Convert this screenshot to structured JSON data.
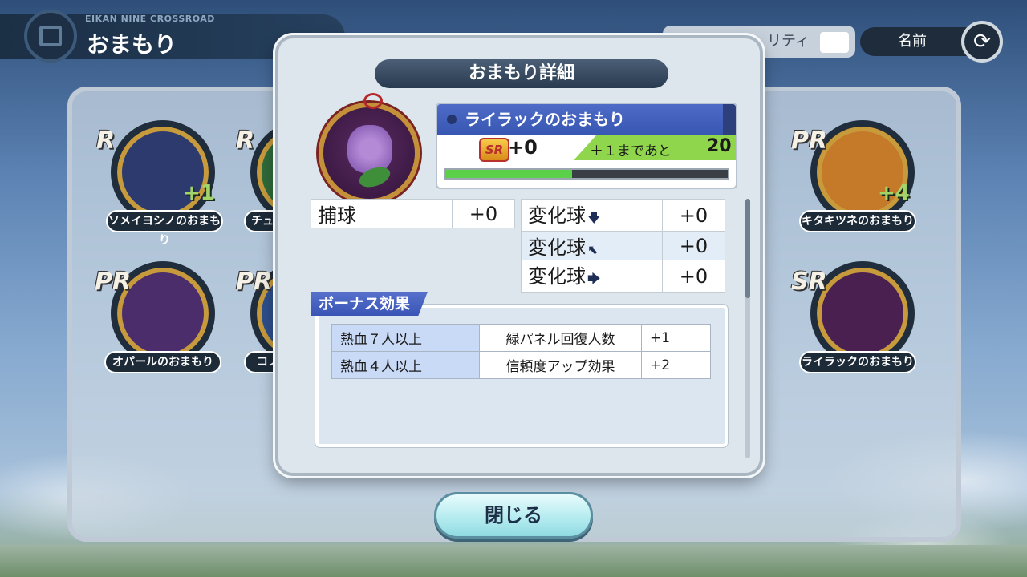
{
  "header": {
    "subtitle": "EIKAN NINE CROSSROAD",
    "title": "おまもり",
    "sort_label": "リティ",
    "name_sort": "名前"
  },
  "background_charms": [
    {
      "rank": "R",
      "label": "ソメイヨシノのおまもり",
      "plus": "+1",
      "color": "#2d3a6e"
    },
    {
      "rank": "R",
      "label": "チュー",
      "plus": "",
      "color": "#2f6a3a"
    },
    {
      "rank": "PR",
      "label": "キタキツネのおまもり",
      "plus": "+4",
      "color": "#c47a28"
    },
    {
      "rank": "PR",
      "label": "オパールのおまもり",
      "plus": "",
      "color": "#4a2d6a"
    },
    {
      "rank": "PR",
      "label": "コノ",
      "plus": "",
      "color": "#2d4f8a"
    },
    {
      "rank": "SR",
      "label": "ライラックのおまもり",
      "plus": "",
      "color": "#4a2050"
    }
  ],
  "modal": {
    "title": "おまもり詳細",
    "charm_name": "ライラックのおまもり",
    "rank": "SR",
    "level": "+0",
    "next_label": "＋１まであと",
    "next_value": "20",
    "progress": 0.45,
    "stats_left": [
      {
        "name": "捕球",
        "value": "+0"
      }
    ],
    "stats_right": [
      {
        "name": "変化球",
        "dir": "down-arrow-icon",
        "glyph": "🡇",
        "value": "+0"
      },
      {
        "name": "変化球",
        "dir": "down-left-arrow-icon",
        "glyph": "⬉",
        "value": "+0"
      },
      {
        "name": "変化球",
        "dir": "right-arrow-icon",
        "glyph": "🡆",
        "value": "+0"
      }
    ],
    "bonus_title": "ボーナス効果",
    "bonuses": [
      {
        "condition": "熱血７人以上",
        "effect": "緑パネル回復人数",
        "value": "+1"
      },
      {
        "condition": "熱血４人以上",
        "effect": "信頼度アップ効果",
        "value": "+2"
      }
    ],
    "close_label": "閉じる"
  }
}
